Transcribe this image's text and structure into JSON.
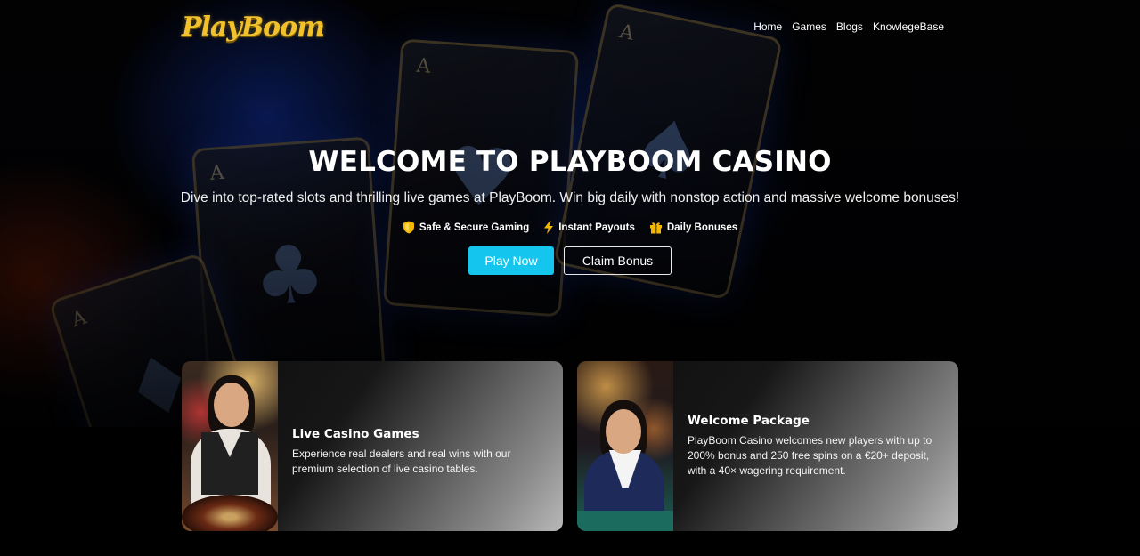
{
  "brand": {
    "logo_text": "PlayBoom"
  },
  "nav": {
    "items": [
      {
        "label": "Home"
      },
      {
        "label": "Games"
      },
      {
        "label": "Blogs"
      },
      {
        "label": "KnowlegeBase"
      }
    ]
  },
  "hero": {
    "title": "WELCOME TO PLAYBOOM CASINO",
    "subtitle": "Dive into top-rated slots and thrilling live games at PlayBoom. Win big daily with nonstop action and massive welcome bonuses!",
    "features": [
      {
        "icon": "shield-icon",
        "label": "Safe & Secure Gaming"
      },
      {
        "icon": "lightning-icon",
        "label": "Instant Payouts"
      },
      {
        "icon": "gift-icon",
        "label": "Daily Bonuses"
      }
    ],
    "buttons": {
      "primary": "Play Now",
      "secondary": "Claim Bonus"
    }
  },
  "promos": [
    {
      "title": "Live Casino Games",
      "description": "Experience real dealers and real wins with our premium selection of live casino tables."
    },
    {
      "title": "Welcome Package",
      "description": "PlayBoom Casino welcomes new players with up to 200% bonus and 250 free spins on a €20+ deposit, with a 40× wagering requirement."
    }
  ],
  "colors": {
    "accent": "#14c6ee",
    "logo_gold": "#f2c12e",
    "feature_icon": "#f5b800",
    "background": "#000000"
  }
}
